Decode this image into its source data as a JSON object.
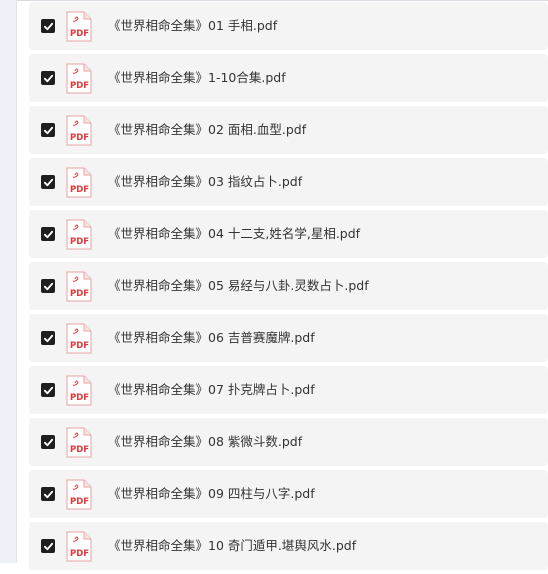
{
  "colors": {
    "row_bg": "#f4f4f5",
    "checkbox": "#1f1f1f",
    "pdf_red": "#e4393c",
    "text": "#333333"
  },
  "files": [
    {
      "name": "《世界相命全集》01 手相.pdf",
      "checked": true,
      "icon": "pdf-file-icon",
      "icon_label": "PDF"
    },
    {
      "name": "《世界相命全集》1-10合集.pdf",
      "checked": true,
      "icon": "pdf-file-icon",
      "icon_label": "PDF"
    },
    {
      "name": "《世界相命全集》02 面相.血型.pdf",
      "checked": true,
      "icon": "pdf-file-icon",
      "icon_label": "PDF"
    },
    {
      "name": "《世界相命全集》03 指纹占卜.pdf",
      "checked": true,
      "icon": "pdf-file-icon",
      "icon_label": "PDF"
    },
    {
      "name": "《世界相命全集》04 十二支,姓名学,星相.pdf",
      "checked": true,
      "icon": "pdf-file-icon",
      "icon_label": "PDF"
    },
    {
      "name": "《世界相命全集》05 易经与八卦.灵数占卜.pdf",
      "checked": true,
      "icon": "pdf-file-icon",
      "icon_label": "PDF"
    },
    {
      "name": "《世界相命全集》06 吉普赛魔牌.pdf",
      "checked": true,
      "icon": "pdf-file-icon",
      "icon_label": "PDF"
    },
    {
      "name": "《世界相命全集》07 扑克牌占卜.pdf",
      "checked": true,
      "icon": "pdf-file-icon",
      "icon_label": "PDF"
    },
    {
      "name": "《世界相命全集》08 紫微斗数.pdf",
      "checked": true,
      "icon": "pdf-file-icon",
      "icon_label": "PDF"
    },
    {
      "name": "《世界相命全集》09 四柱与八字.pdf",
      "checked": true,
      "icon": "pdf-file-icon",
      "icon_label": "PDF"
    },
    {
      "name": "《世界相命全集》10 奇门遁甲.堪舆风水.pdf",
      "checked": true,
      "icon": "pdf-file-icon",
      "icon_label": "PDF"
    }
  ]
}
